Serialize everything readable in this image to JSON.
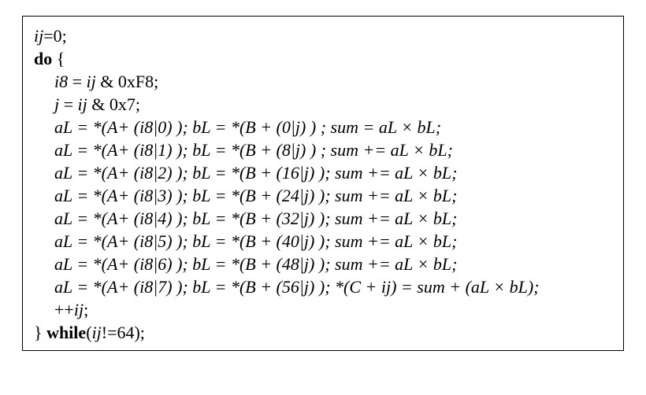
{
  "code": {
    "l1": {
      "ij": "ij",
      "eq": "=0;"
    },
    "l2": {
      "do": "do",
      "brace": " {"
    },
    "i8line": {
      "i8": "i8",
      "eq": " = ",
      "ij": "ij",
      "rest": " & 0xF8;"
    },
    "jline": {
      "j": "j",
      "eq": " = ",
      "ij": "ij",
      "rest": " & 0x7;"
    },
    "rows": [
      {
        "aPart": "aL = *(A+ (i8|0) ); ",
        "bPart": "bL = *(B + (0|j) ) ;  ",
        "sumPart": "sum =  aL × bL;"
      },
      {
        "aPart": "aL = *(A+ (i8|1) ); ",
        "bPart": "bL = *(B + (8|j) ) ;  ",
        "sumPart": "sum += aL × bL;"
      },
      {
        "aPart": "aL = *(A+ (i8|2) ); ",
        "bPart": "bL = *(B + (16|j) ); ",
        "sumPart": "sum += aL × bL;"
      },
      {
        "aPart": "aL = *(A+ (i8|3) ); ",
        "bPart": "bL = *(B + (24|j) ); ",
        "sumPart": "sum += aL × bL;"
      },
      {
        "aPart": "aL = *(A+ (i8|4) ); ",
        "bPart": "bL = *(B + (32|j) ); ",
        "sumPart": "sum += aL × bL;"
      },
      {
        "aPart": "aL = *(A+ (i8|5) ); ",
        "bPart": "bL = *(B + (40|j) ); ",
        "sumPart": "sum += aL × bL;"
      },
      {
        "aPart": "aL = *(A+ (i8|6) ); ",
        "bPart": "bL = *(B + (48|j) ); ",
        "sumPart": "sum += aL × bL;"
      },
      {
        "aPart": "aL = *(A+ (i8|7) ); ",
        "bPart": "bL = *(B + (56|j) ); ",
        "sumPart": "*(C + ij) = sum + (aL × bL);"
      }
    ],
    "incline": {
      "pre": "++",
      "ij": "ij",
      "post": ";"
    },
    "whileline": {
      "brace": "} ",
      "while": "while",
      "open": "(",
      "ij": "ij",
      "rest": "!=64);"
    }
  }
}
